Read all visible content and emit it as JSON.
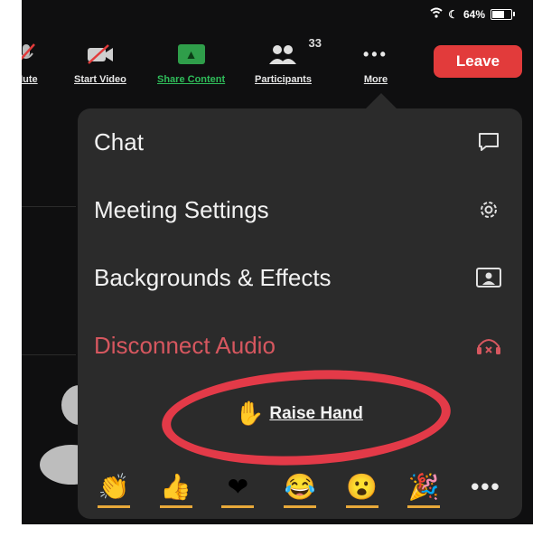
{
  "status": {
    "battery": "64%"
  },
  "toolbar": {
    "mute_label": "Mute",
    "video_label": "Start Video",
    "share_label": "Share Content",
    "participants_label": "Participants",
    "participants_count": "33",
    "more_label": "More",
    "leave_label": "Leave"
  },
  "menu": {
    "items": [
      {
        "label": "Chat",
        "icon": "chat-bubble-icon"
      },
      {
        "label": "Meeting Settings",
        "icon": "gear-icon"
      },
      {
        "label": "Backgrounds & Effects",
        "icon": "background-person-icon"
      },
      {
        "label": "Disconnect Audio",
        "icon": "headphones-disconnect-icon"
      }
    ],
    "raise_hand": "Raise Hand",
    "reactions": [
      "clap",
      "thumbs-up",
      "heart",
      "laugh",
      "surprised",
      "party"
    ],
    "more_dots": "•••"
  },
  "colors": {
    "accent_green": "#2fbd5a",
    "leave_red": "#e23b3b",
    "danger_text": "#d6575f",
    "annotation_red": "#e33a48"
  }
}
